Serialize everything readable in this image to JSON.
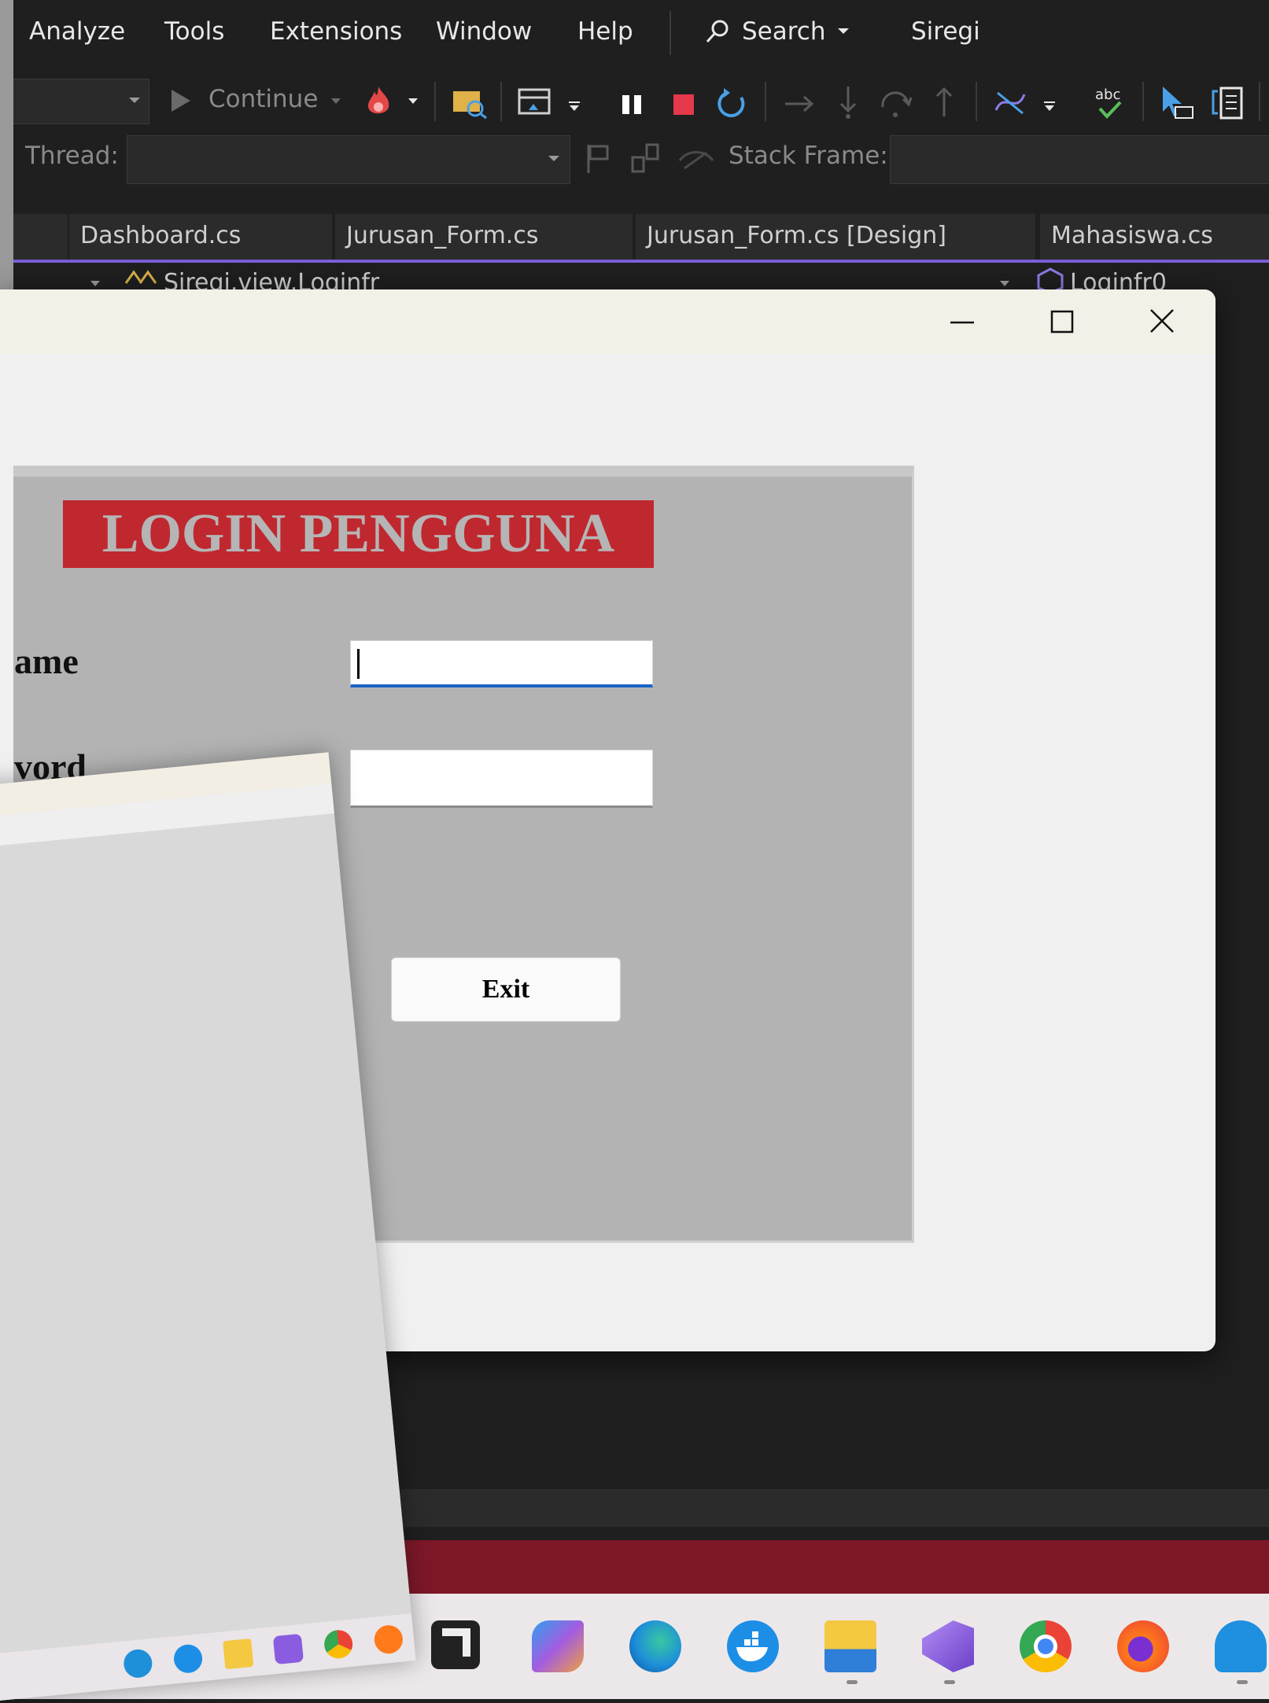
{
  "menubar": {
    "items": [
      "Analyze",
      "Tools",
      "Extensions",
      "Window",
      "Help"
    ],
    "search_label": "Search",
    "solution_name": "Siregi"
  },
  "debug_toolbar": {
    "continue_label": "Continue",
    "thread_label": "Thread:",
    "stack_frame_label": "Stack Frame:"
  },
  "editor_tabs": [
    {
      "label": "Dashboard.cs"
    },
    {
      "label": "Jurusan_Form.cs"
    },
    {
      "label": "Jurusan_Form.cs [Design]"
    },
    {
      "label": "Mahasiswa.cs"
    }
  ],
  "nav": {
    "left": "Siregi.view.Loginfr",
    "right": "Loginfr0"
  },
  "login_form": {
    "title": "LOGIN PENGGUNA",
    "username_label": "ame",
    "password_label": "vord",
    "username_value": "",
    "password_value": "",
    "exit_label": "Exit"
  },
  "colors": {
    "ide_bg": "#1f1f1f",
    "accent": "#7b5fd6",
    "title_banner": "#c0282f",
    "panel": "#b3b3b3",
    "statusbar": "#7d1828"
  },
  "taskbar_icons": [
    "terminal-icon",
    "copilot-icon",
    "edge-icon",
    "docker-icon",
    "file-explorer-icon",
    "visual-studio-icon",
    "chrome-icon",
    "firefox-icon",
    "app-icon"
  ]
}
